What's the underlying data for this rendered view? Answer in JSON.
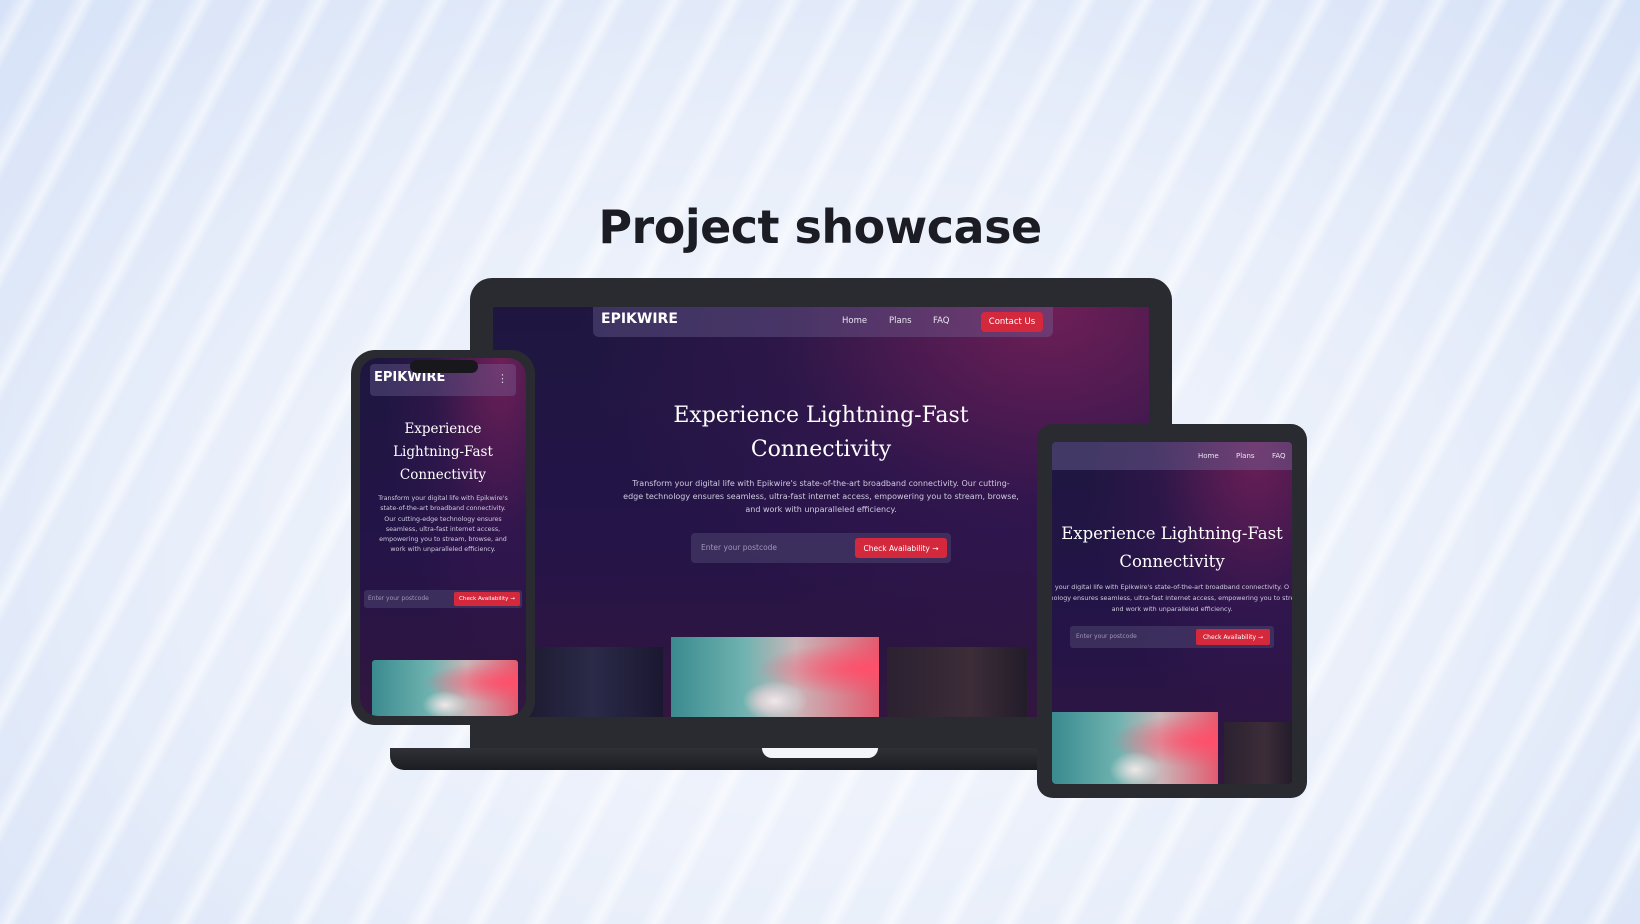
{
  "page": {
    "headline": "Project showcase"
  },
  "laptop": {
    "logo": "EPIKWIRE",
    "nav": [
      "Home",
      "Plans",
      "FAQ"
    ],
    "contact_label": "Contact Us",
    "hero_line1": "Experience Lightning-Fast",
    "hero_line2": "Connectivity",
    "description": "Transform your digital life with Epikwire's state-of-the-art broadband connectivity. Our cutting-edge technology ensures seamless, ultra-fast internet access, empowering you to stream, browse, and work with unparalleled efficiency.",
    "postcode_placeholder": "Enter your postcode",
    "check_label": "Check Availability →"
  },
  "phone": {
    "logo": "EPIKWIRE",
    "menu_icon": "kebab-menu-icon",
    "hero": "Experience Lightning-Fast Connectivity",
    "description": "Transform your digital life with Epikwire's state-of-the-art broadband connectivity. Our cutting-edge technology ensures seamless, ultra-fast internet access, empowering you to stream, browse, and work with unparalleled efficiency.",
    "postcode_placeholder": "Enter your postcode",
    "check_label": "Check Availability →"
  },
  "tablet": {
    "nav": [
      "Home",
      "Plans",
      "FAQ"
    ],
    "hero_line1": "Experience Lightning-Fast",
    "hero_line2": "Connectivity",
    "desc_line1": "your digital life with Epikwire's state-of-the-art broadband connectivity. O",
    "desc_line2": "nology ensures seamless, ultra-fast internet access, empowering you to stre",
    "desc_line3": "and work with unparalleled efficiency.",
    "postcode_placeholder": "Enter your postcode",
    "check_label": "Check Availability →"
  },
  "colors": {
    "accent": "#d4283d",
    "screen_bg": "#1e1640",
    "device_frame": "#2a2b31"
  }
}
